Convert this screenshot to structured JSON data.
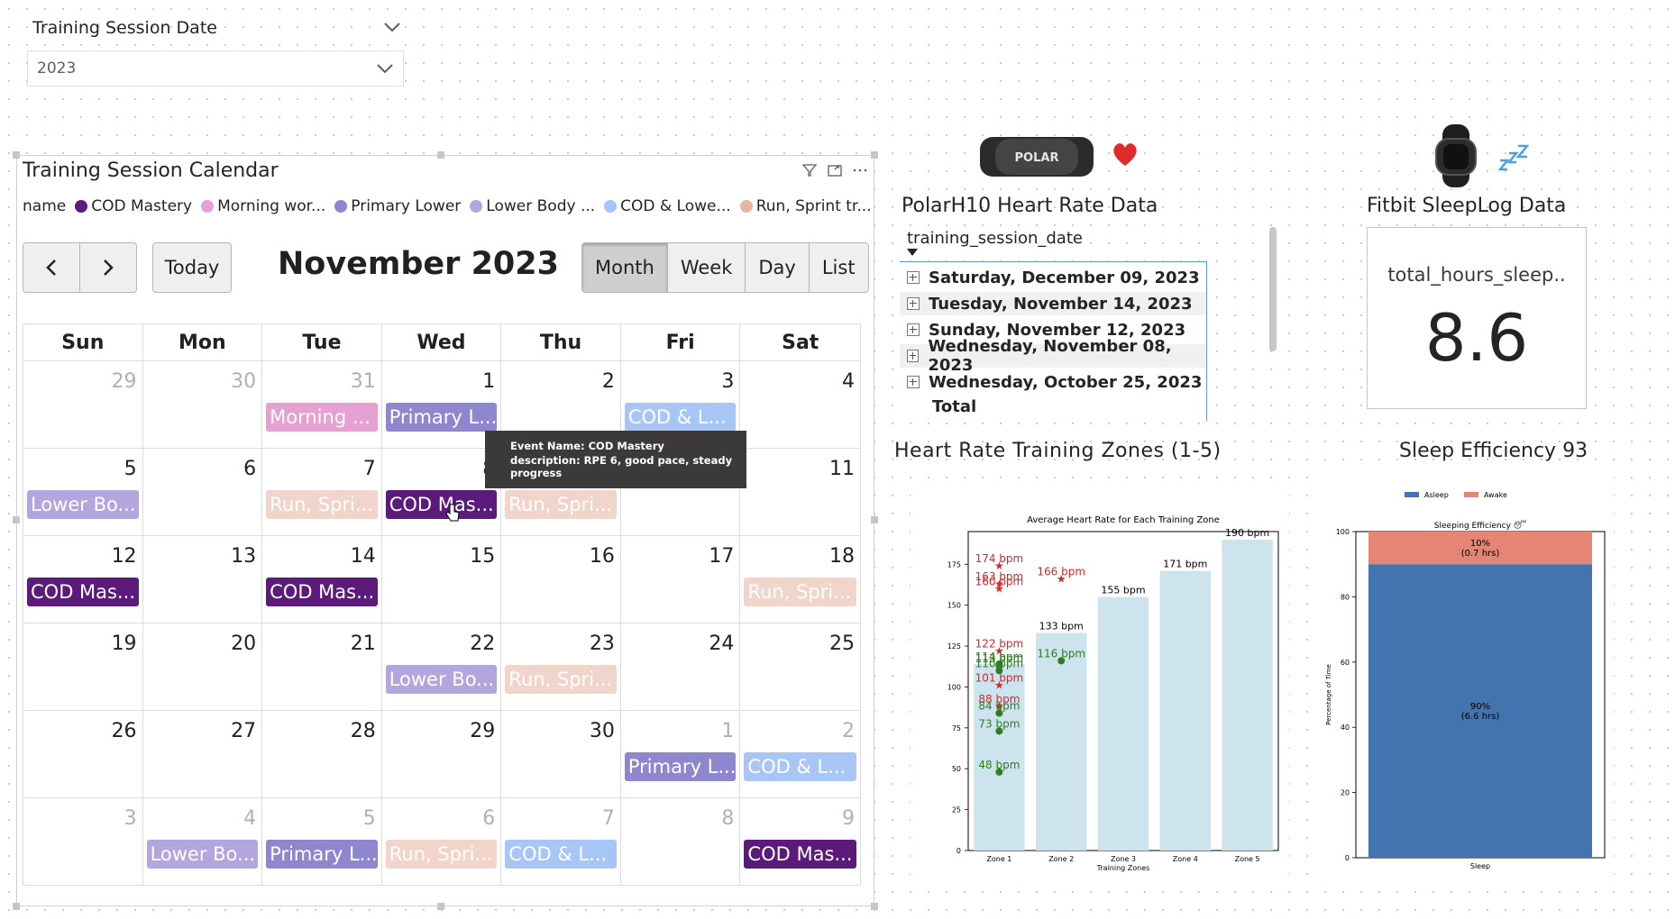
{
  "slicer": {
    "title": "Training Session Date",
    "value": "2023"
  },
  "calendar": {
    "title": "Training Session Calendar",
    "legend_label": "name",
    "legend": [
      {
        "name": "COD Mastery",
        "color": "#5c1a7a"
      },
      {
        "name": "Morning wor...",
        "color": "#e5a1d2"
      },
      {
        "name": "Primary Lower",
        "color": "#8f87cd"
      },
      {
        "name": "Lower Body ...",
        "color": "#b3a6de"
      },
      {
        "name": "COD & Lowe...",
        "color": "#a7c6f5"
      },
      {
        "name": "Run, Sprint tr...",
        "color": "#e6b4a1"
      }
    ],
    "prev_icon": "chevron-left-icon",
    "next_icon": "chevron-right-icon",
    "today": "Today",
    "month_title": "November 2023",
    "views": [
      "Month",
      "Week",
      "Day",
      "List"
    ],
    "active_view": "Month",
    "days_of_week": [
      "Sun",
      "Mon",
      "Tue",
      "Wed",
      "Thu",
      "Fri",
      "Sat"
    ],
    "weeks": [
      [
        {
          "day": "29",
          "other": true
        },
        {
          "day": "30",
          "other": true
        },
        {
          "day": "31",
          "other": true,
          "event": {
            "label": "Morning ...",
            "color": "#e5a1d2"
          }
        },
        {
          "day": "1",
          "event": {
            "label": "Primary L...",
            "color": "#8f87cd"
          }
        },
        {
          "day": "2"
        },
        {
          "day": "3",
          "event": {
            "label": "COD & L...",
            "color": "#a7c6f5"
          }
        },
        {
          "day": "4"
        }
      ],
      [
        {
          "day": "5",
          "event": {
            "label": "Lower Bo...",
            "color": "#b3a6de"
          }
        },
        {
          "day": "6"
        },
        {
          "day": "7",
          "event": {
            "label": "Run, Spri...",
            "color": "#e6b4a1",
            "faded": true
          }
        },
        {
          "day": "8",
          "event": {
            "label": "COD Mas...",
            "color": "#5c1a7a"
          }
        },
        {
          "day": "9",
          "event": {
            "label": "Run, Spri...",
            "color": "#e6b4a1",
            "faded": true
          }
        },
        {
          "day": "10"
        },
        {
          "day": "11"
        }
      ],
      [
        {
          "day": "12",
          "event": {
            "label": "COD Mas...",
            "color": "#5c1a7a"
          }
        },
        {
          "day": "13"
        },
        {
          "day": "14",
          "event": {
            "label": "COD Mas...",
            "color": "#5c1a7a"
          }
        },
        {
          "day": "15"
        },
        {
          "day": "16"
        },
        {
          "day": "17"
        },
        {
          "day": "18",
          "event": {
            "label": "Run, Spri...",
            "color": "#e6b4a1",
            "faded": true
          }
        }
      ],
      [
        {
          "day": "19"
        },
        {
          "day": "20"
        },
        {
          "day": "21"
        },
        {
          "day": "22",
          "event": {
            "label": "Lower Bo...",
            "color": "#b3a6de"
          }
        },
        {
          "day": "23",
          "event": {
            "label": "Run, Spri...",
            "color": "#e6b4a1",
            "faded": true
          }
        },
        {
          "day": "24"
        },
        {
          "day": "25"
        }
      ],
      [
        {
          "day": "26"
        },
        {
          "day": "27"
        },
        {
          "day": "28"
        },
        {
          "day": "29"
        },
        {
          "day": "30"
        },
        {
          "day": "1",
          "other": true,
          "event": {
            "label": "Primary L...",
            "color": "#8f87cd"
          }
        },
        {
          "day": "2",
          "other": true,
          "event": {
            "label": "COD & L...",
            "color": "#a7c6f5"
          }
        }
      ],
      [
        {
          "day": "3",
          "other": true
        },
        {
          "day": "4",
          "other": true,
          "event": {
            "label": "Lower Bo...",
            "color": "#b3a6de"
          }
        },
        {
          "day": "5",
          "other": true,
          "event": {
            "label": "Primary L...",
            "color": "#8f87cd"
          }
        },
        {
          "day": "6",
          "other": true,
          "event": {
            "label": "Run, Spri...",
            "color": "#e6b4a1",
            "faded": true
          }
        },
        {
          "day": "7",
          "other": true,
          "event": {
            "label": "COD & L...",
            "color": "#a7c6f5"
          }
        },
        {
          "day": "8",
          "other": true
        },
        {
          "day": "9",
          "other": true,
          "event": {
            "label": "COD Mas...",
            "color": "#5c1a7a"
          }
        }
      ]
    ],
    "tooltip": {
      "line1": "Event Name: COD Mastery",
      "line2": "description: RPE 6, good pace, steady progress"
    }
  },
  "polar": {
    "title": "PolarH10 Heart Rate Data",
    "device_text": "POLAR",
    "column_header": "training_session_date",
    "rows": [
      "Saturday, December 09, 2023",
      "Tuesday, November 14, 2023",
      "Sunday, November 12, 2023",
      "Wednesday, November 08, 2023",
      "Wednesday, October 25, 2023"
    ],
    "total": "Total"
  },
  "fitbit": {
    "title": "Fitbit SleepLog Data",
    "card_label": "total_hours_sleep..",
    "card_value": "8.6"
  },
  "hr_zones_title": "Heart Rate Training Zones (1-5)",
  "sleep_eff_title": "Sleep Efficiency 93",
  "chart_data": [
    {
      "type": "bar",
      "title": "Average Heart Rate for Each Training Zone",
      "xlabel": "Training Zones",
      "ylabel": "",
      "categories": [
        "Zone 1",
        "Zone 2",
        "Zone 3",
        "Zone 4",
        "Zone 5"
      ],
      "values": [
        114,
        133,
        155,
        171,
        190
      ],
      "bar_labels": [
        "",
        "133 bpm",
        "155 bpm",
        "171 bpm",
        "190 bpm"
      ],
      "ylim": [
        0,
        195
      ],
      "yticks": [
        0,
        25,
        50,
        75,
        100,
        125,
        150,
        175
      ],
      "bar_color": "#cde3ee",
      "star_points": [
        {
          "zone": "Zone 1",
          "y": 174,
          "label": "174 bpm"
        },
        {
          "zone": "Zone 1",
          "y": 163,
          "label": "163 bpm"
        },
        {
          "zone": "Zone 1",
          "y": 160,
          "label": "160 bpm"
        },
        {
          "zone": "Zone 1",
          "y": 122,
          "label": "122 bpm"
        },
        {
          "zone": "Zone 1",
          "y": 101,
          "label": "101 bpm"
        },
        {
          "zone": "Zone 1",
          "y": 88,
          "label": "88 bpm"
        },
        {
          "zone": "Zone 2",
          "y": 166,
          "label": "166 bpm"
        }
      ],
      "star_color": "#d62728",
      "dot_points": [
        {
          "zone": "Zone 1",
          "y": 114,
          "label": "114 bpm"
        },
        {
          "zone": "Zone 1",
          "y": 113,
          "label": "113 bpm"
        },
        {
          "zone": "Zone 1",
          "y": 110,
          "label": "110 bpm"
        },
        {
          "zone": "Zone 1",
          "y": 84,
          "label": "84 bpm"
        },
        {
          "zone": "Zone 1",
          "y": 73,
          "label": "73 bpm"
        },
        {
          "zone": "Zone 1",
          "y": 48,
          "label": "48 bpm"
        },
        {
          "zone": "Zone 2",
          "y": 116,
          "label": "116 bpm"
        }
      ],
      "dot_color": "#2e7d1f"
    },
    {
      "type": "bar",
      "title": "Sleeping Efficiency 😴",
      "xlabel": "",
      "ylabel": "Percentage of Time",
      "categories": [
        "Sleep"
      ],
      "series": [
        {
          "name": "Asleep",
          "values": [
            90
          ],
          "label": "90%\n(6.6 hrs)",
          "color": "#4474b0"
        },
        {
          "name": "Awake",
          "values": [
            10
          ],
          "label": "10%\n(0.7 hrs)",
          "color": "#e48575"
        }
      ],
      "stacked": true,
      "ylim": [
        0,
        100
      ],
      "yticks": [
        0,
        20,
        40,
        60,
        80,
        100
      ],
      "legend": "top"
    }
  ]
}
